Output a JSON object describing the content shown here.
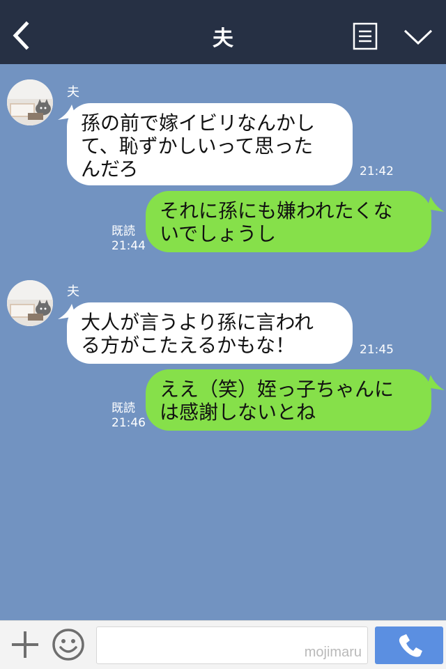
{
  "header": {
    "title": "夫",
    "back_icon": "chevron-left-icon",
    "notes_icon": "notes-icon",
    "menu_icon": "chevron-down-icon"
  },
  "messages": [
    {
      "direction": "in",
      "sender": "夫",
      "lines": [
        "孫の前で嫁イビリなんかし",
        "て、恥ずかしいって思った",
        "んだろ"
      ],
      "time": "21:42"
    },
    {
      "direction": "out",
      "read": "既読",
      "lines": [
        "それに孫にも嫌われたくな",
        "いでしょうし"
      ],
      "time": "21:44"
    },
    {
      "direction": "in",
      "sender": "夫",
      "lines": [
        "大人が言うより孫に言われ",
        "る方がこたえるかもな！"
      ],
      "time": "21:45"
    },
    {
      "direction": "out",
      "read": "既読",
      "lines": [
        "ええ（笑）姪っ子ちゃんに",
        "は感謝しないとね"
      ],
      "time": "21:46"
    }
  ],
  "bottom_bar": {
    "input_value": "",
    "watermark": "mojimaru",
    "plus_icon": "plus-icon",
    "emoji_icon": "smiley-icon",
    "call_icon": "phone-icon"
  },
  "colors": {
    "header_bg": "#263044",
    "chat_bg": "#7293c1",
    "incoming_bubble": "#ffffff",
    "outgoing_bubble": "#86e04a",
    "call_button": "#5b8fe1"
  }
}
